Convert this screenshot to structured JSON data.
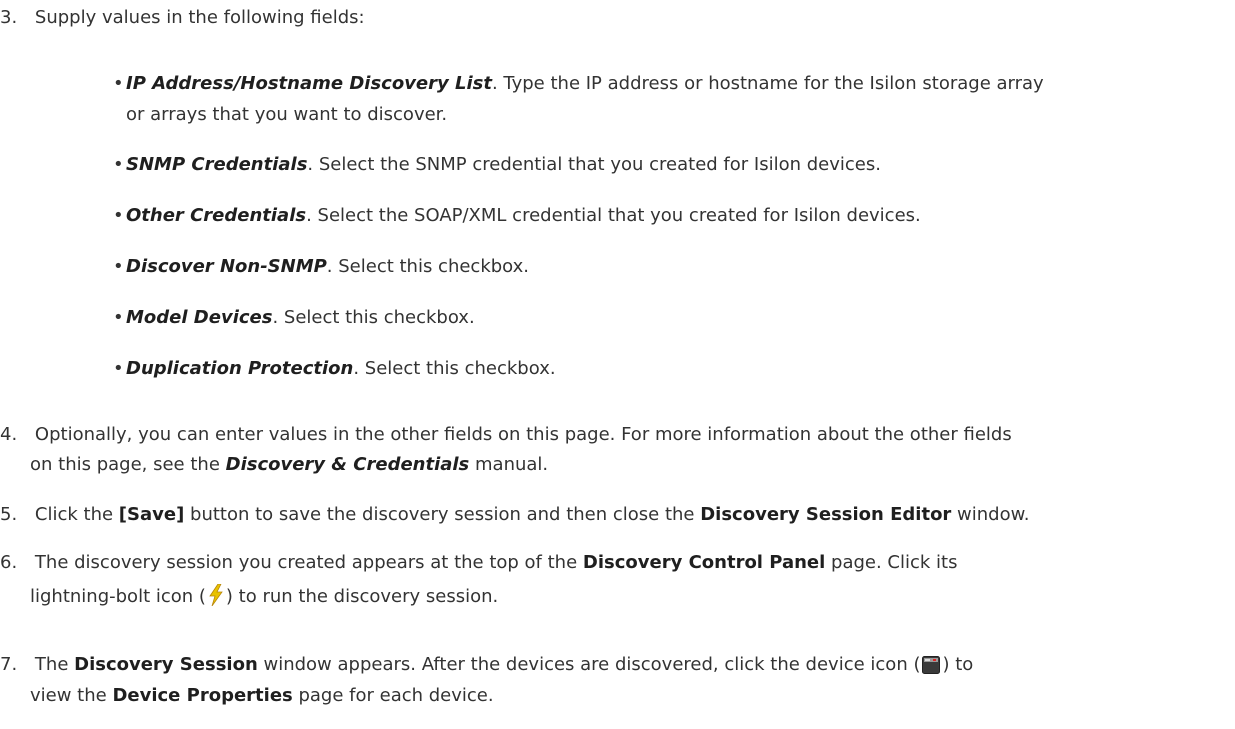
{
  "steps": {
    "s3": {
      "num": "3.",
      "text": "Supply values in the following fields:"
    },
    "s4": {
      "num": "4.",
      "line1": "Optionally, you can enter values in the other fields on this page. For more information about the other fields",
      "line2_pre": "on this page, see the ",
      "line2_term": "Discovery & Credentials",
      "line2_post": " manual."
    },
    "s5": {
      "num": "5.",
      "pre": "Click the ",
      "btn": "[Save]",
      "mid": " button to save the discovery session and then close the ",
      "win": "Discovery Session Editor",
      "post": " window."
    },
    "s6": {
      "num": "6.",
      "line1_pre": "The discovery session you created appears at the top of the ",
      "line1_ui": "Discovery Control Panel",
      "line1_post": " page. Click its",
      "line2_pre": "lightning-bolt icon (",
      "line2_post": ") to run the discovery session."
    },
    "s7": {
      "num": "7.",
      "line1_pre": "The ",
      "line1_ui": "Discovery Session",
      "line1_mid": " window appears. After the devices are discovered, click the device icon (",
      "line1_post": ") to",
      "line2_pre": "view the ",
      "line2_ui": "Device Properties",
      "line2_post": " page for each device."
    }
  },
  "bullets": [
    {
      "term": "IP Address/Hostname Discovery List",
      "desc": ". Type the IP address or hostname for the Isilon storage array",
      "desc2": "or arrays that you want to discover."
    },
    {
      "term": "SNMP Credentials",
      "desc": ". Select the SNMP credential that you created for Isilon devices."
    },
    {
      "term": "Other Credentials",
      "desc": ". Select the SOAP/XML credential that you created for Isilon devices."
    },
    {
      "term": "Discover Non-SNMP",
      "desc": ". Select this checkbox."
    },
    {
      "term": "Model Devices",
      "desc": ". Select this checkbox."
    },
    {
      "term": "Duplication Protection",
      "desc": ". Select this checkbox."
    }
  ],
  "bullet_char": "•",
  "icons": {
    "lightning": "lightning-bolt-icon",
    "device": "device-icon"
  }
}
